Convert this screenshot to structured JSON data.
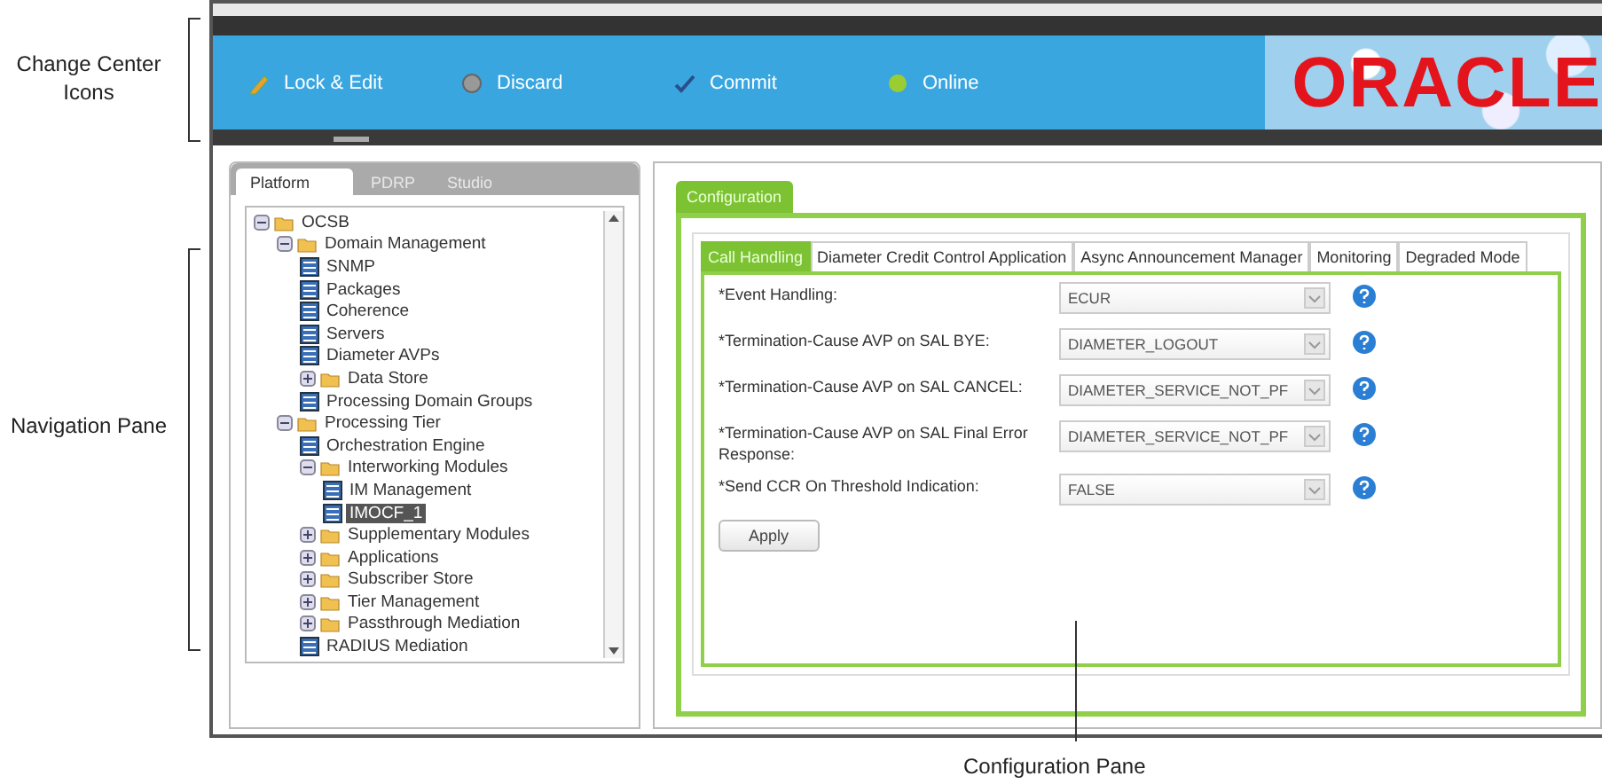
{
  "callouts": [
    {
      "kind": "left",
      "text": "Change Center Icons"
    },
    {
      "kind": "left",
      "text": "Navigation Pane"
    },
    {
      "kind": "bottom",
      "text": "Configuration Pane"
    }
  ],
  "change_center": [
    {
      "kind": "edit",
      "label": "Lock & Edit"
    },
    {
      "kind": "discard",
      "label": "Discard"
    },
    {
      "kind": "commit",
      "label": "Commit"
    },
    {
      "kind": "status",
      "label": "Online",
      "color": "#9acd32"
    }
  ],
  "logo": "ORACLE",
  "nav_tabs": [
    {
      "label": "Platform",
      "selected": true
    },
    {
      "label": "PDRP",
      "selected": false
    },
    {
      "label": "Studio",
      "selected": false
    }
  ],
  "tree": [
    {
      "kind": "folder",
      "label": "OCSB",
      "expanded": true,
      "selected": false,
      "children": [
        {
          "kind": "folder",
          "label": "Domain Management",
          "expanded": true,
          "selected": false,
          "children": [
            {
              "kind": "leaf",
              "label": "SNMP",
              "selected": false
            },
            {
              "kind": "leaf",
              "label": "Packages",
              "selected": false
            },
            {
              "kind": "leaf",
              "label": "Coherence",
              "selected": false
            },
            {
              "kind": "leaf",
              "label": "Servers",
              "selected": false
            },
            {
              "kind": "leaf",
              "label": "Diameter AVPs",
              "selected": false
            },
            {
              "kind": "folder",
              "label": "Data Store",
              "expanded": false,
              "selected": false
            },
            {
              "kind": "leaf",
              "label": "Processing Domain Groups",
              "selected": false
            }
          ]
        },
        {
          "kind": "folder",
          "label": "Processing Tier",
          "expanded": true,
          "selected": false,
          "children": [
            {
              "kind": "leaf",
              "label": "Orchestration Engine",
              "selected": false
            },
            {
              "kind": "folder",
              "label": "Interworking Modules",
              "expanded": true,
              "selected": false,
              "children": [
                {
                  "kind": "leaf",
                  "label": "IM Management",
                  "selected": false
                },
                {
                  "kind": "leaf",
                  "label": "IMOCF_1",
                  "selected": true
                }
              ]
            },
            {
              "kind": "folder",
              "label": "Supplementary Modules",
              "expanded": false,
              "selected": false
            },
            {
              "kind": "folder",
              "label": "Applications",
              "expanded": false,
              "selected": false
            },
            {
              "kind": "folder",
              "label": "Subscriber Store",
              "expanded": false,
              "selected": false
            },
            {
              "kind": "folder",
              "label": "Tier Management",
              "expanded": false,
              "selected": false
            },
            {
              "kind": "folder",
              "label": "Passthrough Mediation",
              "expanded": false,
              "selected": false
            },
            {
              "kind": "leaf",
              "label": "RADIUS Mediation",
              "selected": false
            }
          ]
        }
      ]
    }
  ],
  "config_tab": "Configuration",
  "config_tabs": [
    {
      "label": "Call Handling",
      "selected": true
    },
    {
      "label": "Diameter Credit Control Application",
      "selected": false
    },
    {
      "label": "Async Announcement Manager",
      "selected": false
    },
    {
      "label": "Monitoring",
      "selected": false
    },
    {
      "label": "Degraded Mode",
      "selected": false
    }
  ],
  "fields": [
    {
      "label": "*Event Handling:",
      "value": "ECUR"
    },
    {
      "label": "*Termination-Cause AVP on SAL BYE:",
      "value": "DIAMETER_LOGOUT"
    },
    {
      "label": "*Termination-Cause AVP on SAL CANCEL:",
      "value": "DIAMETER_SERVICE_NOT_PF"
    },
    {
      "label": "*Termination-Cause AVP on SAL Final Error Response:",
      "value": "DIAMETER_SERVICE_NOT_PF"
    },
    {
      "label": "*Send CCR On Threshold Indication:",
      "value": "FALSE"
    }
  ],
  "apply_button": "Apply"
}
